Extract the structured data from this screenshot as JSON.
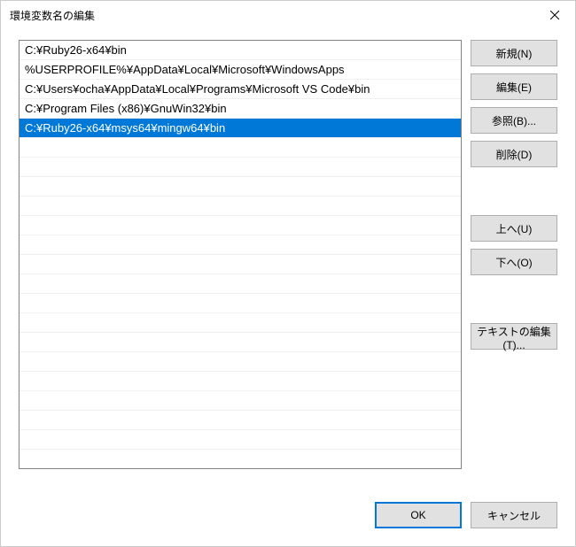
{
  "title": "環境変数名の編集",
  "list": {
    "items": [
      "C:¥Ruby26-x64¥bin",
      "%USERPROFILE%¥AppData¥Local¥Microsoft¥WindowsApps",
      "C:¥Users¥ocha¥AppData¥Local¥Programs¥Microsoft VS Code¥bin",
      "C:¥Program Files (x86)¥GnuWin32¥bin",
      "C:¥Ruby26-x64¥msys64¥mingw64¥bin"
    ],
    "selected_index": 4
  },
  "buttons": {
    "new": "新規(N)",
    "edit": "編集(E)",
    "browse": "参照(B)...",
    "delete": "削除(D)",
    "up": "上へ(U)",
    "down": "下へ(O)",
    "edit_text": "テキストの編集(T)...",
    "ok": "OK",
    "cancel": "キャンセル"
  }
}
